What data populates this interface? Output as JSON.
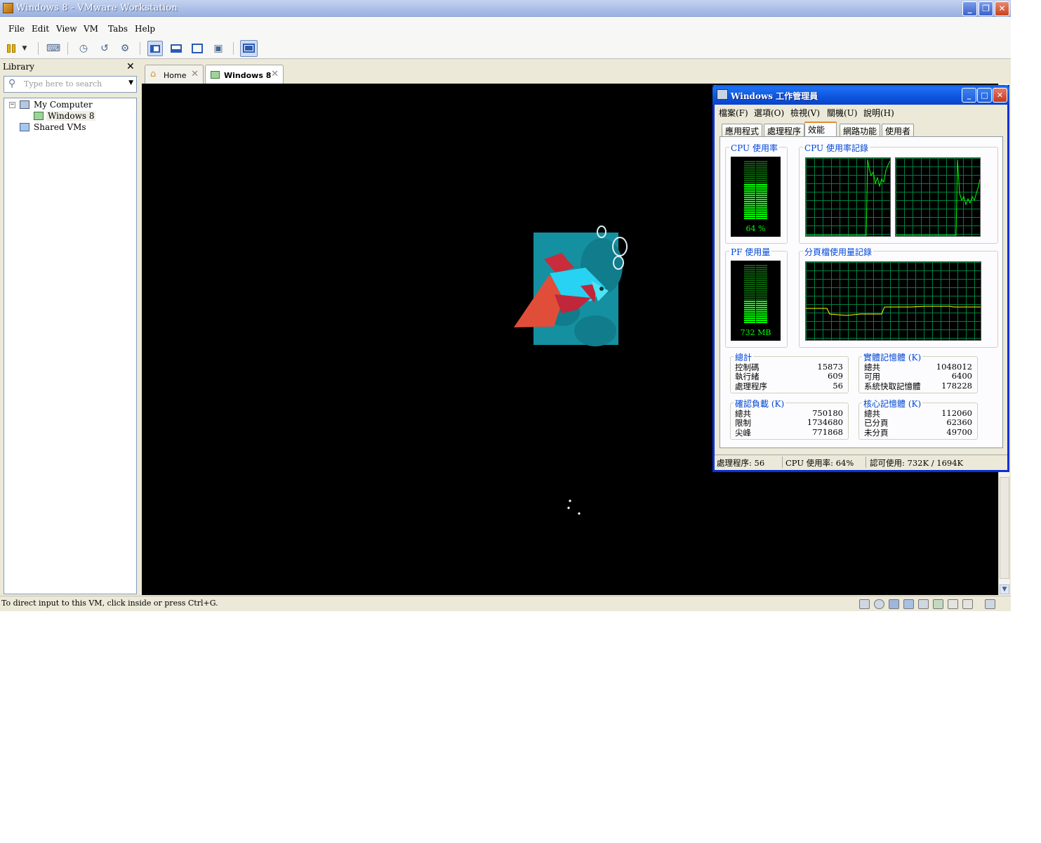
{
  "vmware": {
    "title": "Windows 8 - VMware Workstation",
    "menu": [
      "File",
      "Edit",
      "View",
      "VM",
      "Tabs",
      "Help"
    ],
    "library": {
      "heading": "Library",
      "search_placeholder": "Type here to search",
      "tree": [
        "My Computer",
        "Windows 8",
        "Shared VMs"
      ]
    },
    "tabs": [
      "Home",
      "Windows 8"
    ],
    "status_message": "To direct input to this VM, click inside or press Ctrl+G."
  },
  "taskmgr": {
    "title": "Windows 工作管理員",
    "menu": [
      "檔案(F)",
      "選項(O)",
      "檢視(V)",
      "關機(U)",
      "說明(H)"
    ],
    "tabs": [
      "應用程式",
      "處理程序",
      "效能",
      "網路功能",
      "使用者"
    ],
    "active_tab": "效能",
    "cpu_usage_label": "CPU 使用率",
    "cpu_usage_value": "64 %",
    "cpu_usage_fraction": 0.64,
    "cpu_history_label": "CPU 使用率記錄",
    "pf_usage_label": "PF 使用量",
    "pf_usage_value": "732 MB",
    "pf_history_label": "分頁檔使用量記錄",
    "totals": {
      "label": "總計",
      "rows": [
        {
          "name": "控制碼",
          "value": "15873"
        },
        {
          "name": "執行緒",
          "value": "609"
        },
        {
          "name": "處理程序",
          "value": "56"
        }
      ]
    },
    "physical_memory": {
      "label": "實體記憶體 (K)",
      "rows": [
        {
          "name": "總共",
          "value": "1048012"
        },
        {
          "name": "可用",
          "value": "6400"
        },
        {
          "name": "系統快取記憶體",
          "value": "178228"
        }
      ]
    },
    "commit_charge": {
      "label": "確認負載 (K)",
      "rows": [
        {
          "name": "總共",
          "value": "750180"
        },
        {
          "name": "限制",
          "value": "1734680"
        },
        {
          "name": "尖峰",
          "value": "771868"
        }
      ]
    },
    "kernel_memory": {
      "label": "核心記憶體 (K)",
      "rows": [
        {
          "name": "總共",
          "value": "112060"
        },
        {
          "name": "已分頁",
          "value": "62360"
        },
        {
          "name": "未分頁",
          "value": "49700"
        }
      ]
    },
    "status": {
      "processes": "處理程序: 56",
      "cpu": "CPU 使用率: 64%",
      "commit": "認可使用: 732K / 1694K"
    }
  }
}
